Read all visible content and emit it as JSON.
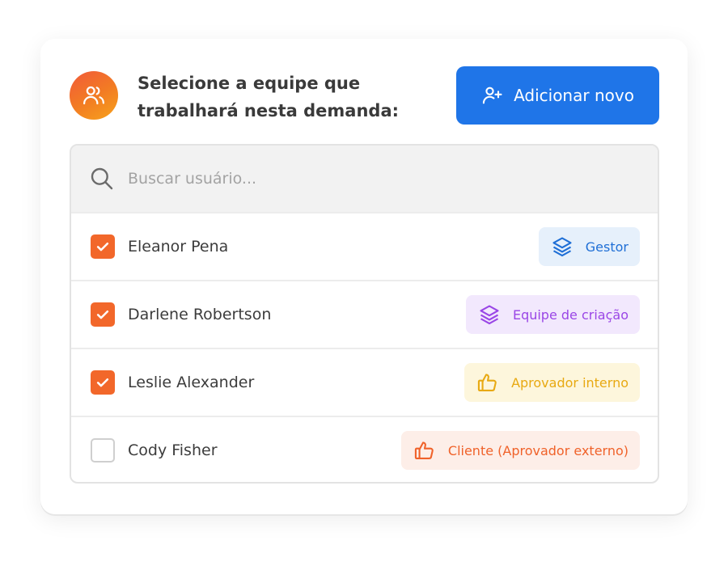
{
  "header": {
    "title_line1": "Selecione a equipe que",
    "title_line2": "trabalhará nesta demanda:",
    "add_button_label": "Adicionar novo"
  },
  "search": {
    "placeholder": "Buscar usuário..."
  },
  "members": [
    {
      "name": "Eleanor Pena",
      "checked": true,
      "role": "Gestor",
      "role_icon": "layers-icon",
      "role_color": "#1f6fd6"
    },
    {
      "name": "Darlene Robertson",
      "checked": true,
      "role": "Equipe de criação",
      "role_icon": "layers-icon",
      "role_color": "#9a46e6"
    },
    {
      "name": "Leslie Alexander",
      "checked": true,
      "role": "Aprovador interno",
      "role_icon": "thumbs-up-icon",
      "role_color": "#e8a912"
    },
    {
      "name": "Cody Fisher",
      "checked": false,
      "role": "Cliente (Aprovador externo)",
      "role_icon": "thumbs-up-icon",
      "role_color": "#f0622a"
    }
  ],
  "colors": {
    "accent_blue": "#1f75e8",
    "checkbox_orange": "#f2672a"
  }
}
